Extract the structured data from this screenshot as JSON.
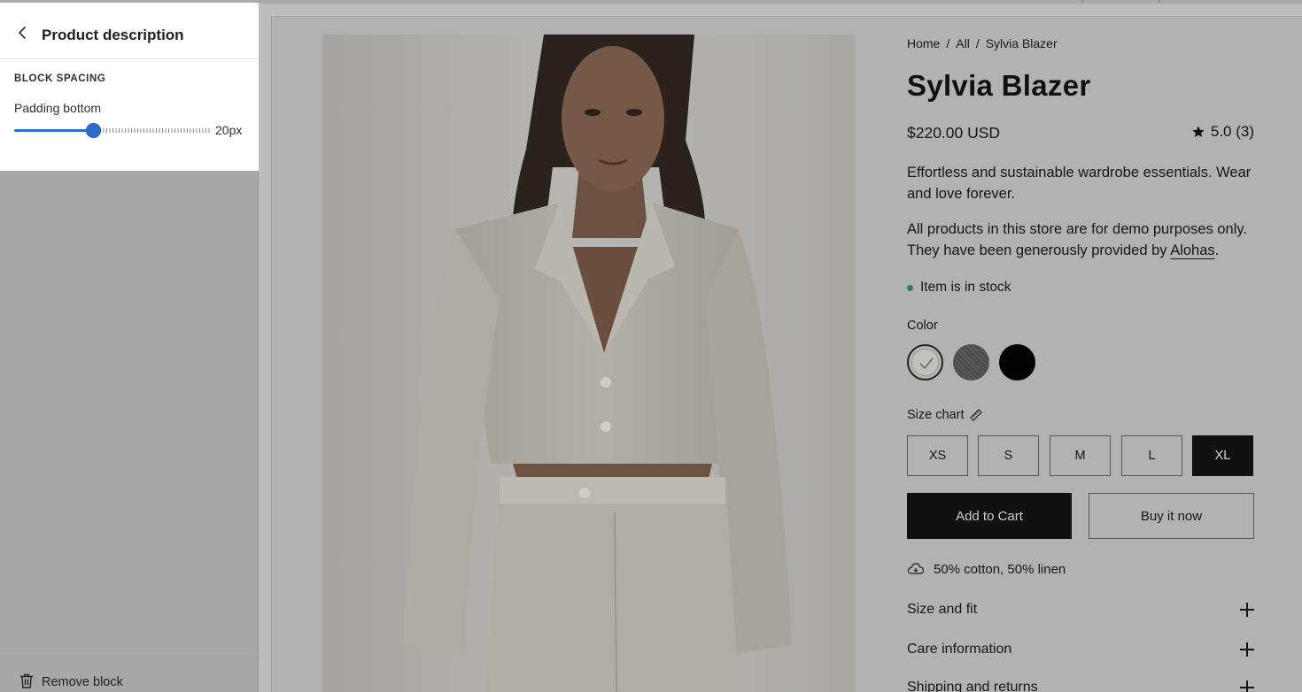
{
  "editor": {
    "title": "Product description",
    "section_label": "BLOCK SPACING",
    "padding_bottom": {
      "label": "Padding bottom",
      "value_text": "20px",
      "value_fraction": 0.4
    },
    "remove_label": "Remove block"
  },
  "product": {
    "breadcrumb": [
      "Home",
      "All",
      "Sylvia Blazer"
    ],
    "breadcrumb_sep": "/",
    "title": "Sylvia Blazer",
    "price": "$220.00 USD",
    "rating": "5.0 (3)",
    "description_1": "Effortless and sustainable wardrobe essentials. Wear and love forever.",
    "description_2_prefix": "All products in this store are for demo purposes only. They have been generously provided by ",
    "description_2_link": "Alohas",
    "description_2_suffix": ".",
    "stock_text": "Item is in stock",
    "color_label": "Color",
    "colors": [
      "#c2c1bd",
      "#4d4d4d",
      "#030303"
    ],
    "size_label": "Size chart",
    "sizes": [
      "XS",
      "S",
      "M",
      "L",
      "XL"
    ],
    "selected_size": "XL",
    "add_to_cart": "Add to Cart",
    "buy_now": "Buy it now",
    "material": "50% cotton, 50% linen",
    "accordions": [
      "Size and fit",
      "Care information",
      "Shipping and returns"
    ]
  },
  "colors": {
    "accent": "#2c6ecb",
    "in_stock": "#3a7a45",
    "button_dark": "#111111"
  }
}
